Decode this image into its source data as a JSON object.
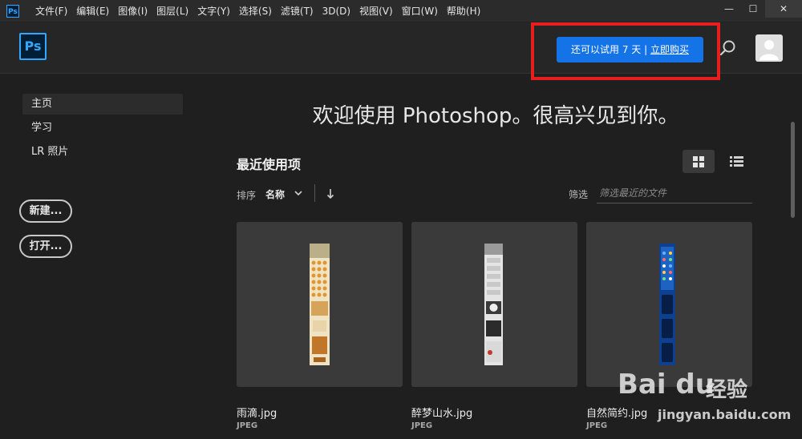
{
  "app": {
    "logo_text": "Ps",
    "menus": [
      "文件(F)",
      "编辑(E)",
      "图像(I)",
      "图层(L)",
      "文字(Y)",
      "选择(S)",
      "滤镜(T)",
      "3D(D)",
      "视图(V)",
      "窗口(W)",
      "帮助(H)"
    ],
    "window_controls": {
      "minimize": "—",
      "maximize": "☐",
      "close": "✕"
    }
  },
  "header": {
    "trial_text": "还可以试用 7 天 | ",
    "buy_link": "立即购买"
  },
  "sidebar": {
    "items": [
      {
        "label": "主页",
        "active": true
      },
      {
        "label": "学习",
        "active": false
      },
      {
        "label": "LR 照片",
        "active": false
      }
    ],
    "new_button": "新建...",
    "open_button": "打开..."
  },
  "main": {
    "welcome": "欢迎使用 Photoshop。很高兴见到你。",
    "recent_title": "最近使用项",
    "sort_label": "排序",
    "sort_value": "名称",
    "filter_label": "筛选",
    "filter_placeholder": "筛选最近的文件",
    "files": [
      {
        "name": "雨滴.jpg",
        "type": "JPEG"
      },
      {
        "name": "醉梦山水.jpg",
        "type": "JPEG"
      },
      {
        "name": "自然简约.jpg",
        "type": "JPEG"
      }
    ]
  },
  "watermark": {
    "brand": "Bai du",
    "jingyan": "经验",
    "url": "jingyan.baidu.com"
  },
  "colors": {
    "accent": "#1473e6",
    "highlight_box": "#e61e1e",
    "ps_blue": "#31a8ff"
  }
}
